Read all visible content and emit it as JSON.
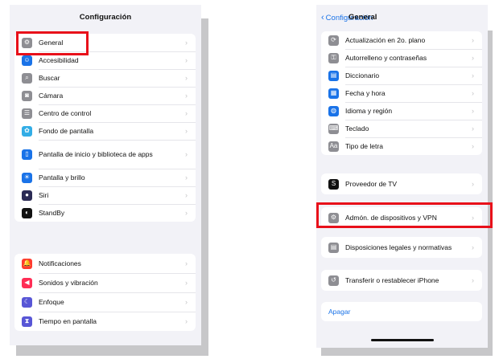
{
  "left_screen": {
    "title": "Configuración",
    "group1": [
      {
        "label": "General",
        "icon": "gear-icon",
        "color": "#8e8e93",
        "glyph": "⚙"
      },
      {
        "label": "Accesibilidad",
        "icon": "accessibility-icon",
        "color": "#1a73e8",
        "glyph": "☺"
      },
      {
        "label": "Buscar",
        "icon": "search-icon",
        "color": "#8e8e93",
        "glyph": "⌕"
      },
      {
        "label": "Cámara",
        "icon": "camera-icon",
        "color": "#8e8e93",
        "glyph": "◙"
      },
      {
        "label": "Centro de control",
        "icon": "control-center-icon",
        "color": "#8e8e93",
        "glyph": "☰"
      },
      {
        "label": "Fondo de pantalla",
        "icon": "wallpaper-icon",
        "color": "#32ade6",
        "glyph": "✿"
      },
      {
        "label": "Pantalla de inicio y biblioteca de apps",
        "icon": "home-screen-icon",
        "color": "#1a73e8",
        "glyph": "▯"
      },
      {
        "label": "Pantalla y brillo",
        "icon": "brightness-icon",
        "color": "#1a73e8",
        "glyph": "☀"
      },
      {
        "label": "Siri",
        "icon": "siri-icon",
        "color": "#2b2b55",
        "glyph": "●"
      },
      {
        "label": "StandBy",
        "icon": "standby-icon",
        "color": "#111111",
        "glyph": "◐"
      }
    ],
    "group2": [
      {
        "label": "Notificaciones",
        "icon": "bell-icon",
        "color": "#ff3b30",
        "glyph": "🔔"
      },
      {
        "label": "Sonidos y vibración",
        "icon": "speaker-icon",
        "color": "#ff2d55",
        "glyph": "◀"
      },
      {
        "label": "Enfoque",
        "icon": "moon-icon",
        "color": "#5856d6",
        "glyph": "☾"
      },
      {
        "label": "Tiempo en pantalla",
        "icon": "hourglass-icon",
        "color": "#5856d6",
        "glyph": "⧗"
      }
    ]
  },
  "right_screen": {
    "back_label": "Configuración",
    "title": "General",
    "group1": [
      {
        "label": "Actualización en 2o. plano",
        "icon": "background-refresh-icon",
        "color": "#8e8e93",
        "glyph": "⟳"
      },
      {
        "label": "Autorrelleno y contraseñas",
        "icon": "key-icon",
        "color": "#8e8e93",
        "glyph": "⚿"
      },
      {
        "label": "Diccionario",
        "icon": "book-icon",
        "color": "#1a73e8",
        "glyph": "▤"
      },
      {
        "label": "Fecha y hora",
        "icon": "calendar-icon",
        "color": "#1a73e8",
        "glyph": "▦"
      },
      {
        "label": "Idioma y región",
        "icon": "globe-icon",
        "color": "#1a73e8",
        "glyph": "◍"
      },
      {
        "label": "Teclado",
        "icon": "keyboard-icon",
        "color": "#8e8e93",
        "glyph": "⌨"
      },
      {
        "label": "Tipo de letra",
        "icon": "font-icon",
        "color": "#8e8e93",
        "glyph": "Aa"
      }
    ],
    "group2": [
      {
        "label": "Proveedor de TV",
        "icon": "tv-provider-icon",
        "color": "#111111",
        "glyph": "S"
      }
    ],
    "group3": [
      {
        "label": "Admón. de dispositivos y VPN",
        "icon": "device-management-icon",
        "color": "#8e8e93",
        "glyph": "⚙"
      }
    ],
    "group4": [
      {
        "label": "Disposiciones legales y normativas",
        "icon": "legal-icon",
        "color": "#8e8e93",
        "glyph": "▤"
      }
    ],
    "group5": [
      {
        "label": "Transferir o restablecer iPhone",
        "icon": "reset-icon",
        "color": "#8e8e93",
        "glyph": "↺"
      }
    ],
    "group6": [
      {
        "label": "Apagar"
      }
    ]
  },
  "colors": {
    "highlight": "#e8101a",
    "accent": "#1a73e8",
    "background": "#f2f2f7"
  }
}
